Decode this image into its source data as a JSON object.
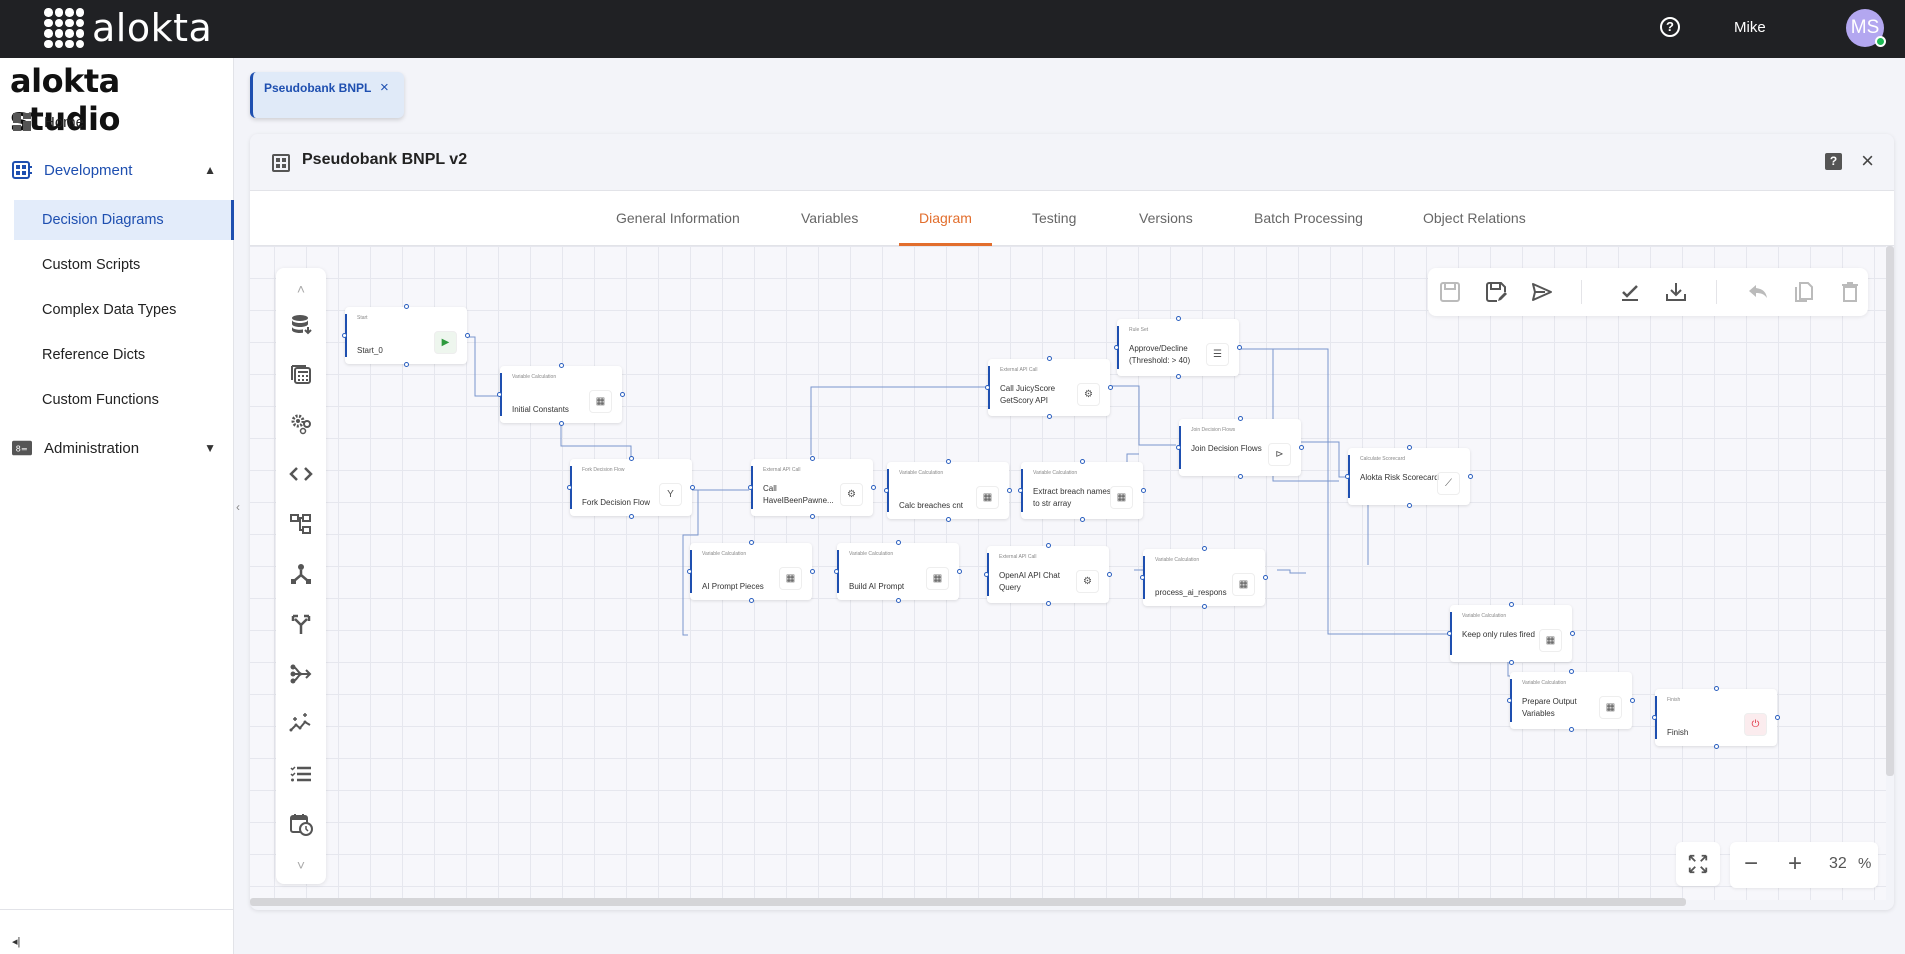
{
  "topbar": {
    "brand": "alokta",
    "help_icon": "help-circle-icon",
    "user_name": "Mike",
    "avatar_initials": "MS",
    "status_color": "#1db954"
  },
  "sidebar": {
    "title": "alokta studio",
    "items": [
      {
        "label": "Home",
        "icon": "dashboard-icon"
      },
      {
        "label": "Development",
        "icon": "development-icon",
        "expanded": true
      },
      {
        "label": "Administration",
        "icon": "admin-card-icon",
        "expanded": false
      }
    ],
    "sub_items": [
      {
        "label": "Decision Diagrams",
        "active": true
      },
      {
        "label": "Custom Scripts"
      },
      {
        "label": "Complex Data Types"
      },
      {
        "label": "Reference Dicts"
      },
      {
        "label": "Custom Functions"
      }
    ],
    "collapse_icon": "◂|",
    "toggle_icon": "‹"
  },
  "doc_tab": {
    "label": "Pseudobank BNPL",
    "close": "×"
  },
  "card": {
    "title": "Pseudobank BNPL v2",
    "help": "?",
    "close": "×"
  },
  "tabs": [
    {
      "label": "General Information"
    },
    {
      "label": "Variables"
    },
    {
      "label": "Diagram",
      "active": true
    },
    {
      "label": "Testing"
    },
    {
      "label": "Versions"
    },
    {
      "label": "Batch Processing"
    },
    {
      "label": "Object Relations"
    }
  ],
  "accent": "#e26e2d",
  "primary": "#1e4fb0",
  "palette": {
    "scroll_up": "˄",
    "scroll_down": "˅",
    "items": [
      "data-source-icon",
      "variable-calculation-icon",
      "external-api-icon",
      "custom-script-icon",
      "decision-tree-icon",
      "join-icon",
      "fork-icon",
      "merge-icon",
      "scorecard-icon",
      "rule-set-icon",
      "schedule-icon"
    ]
  },
  "toolbar": {
    "items": [
      "save-icon",
      "save-as-icon",
      "publish-icon",
      "validate-icon",
      "download-icon",
      "undo-icon",
      "copy-icon",
      "delete-icon"
    ]
  },
  "zoom": {
    "minus": "−",
    "plus": "+",
    "value": "32",
    "unit": "%"
  },
  "nodes": [
    {
      "id": "start",
      "type": "Start",
      "label": "Start_0",
      "icon": "play"
    },
    {
      "id": "initconst",
      "type": "Variable Calculation",
      "label": "Initial Constants",
      "icon": "calc"
    },
    {
      "id": "fork",
      "type": "Fork Decision Flow",
      "label": "Fork Decision Flow",
      "icon": "fork"
    },
    {
      "id": "hibp",
      "type": "External API Call",
      "label": "Call HaveIBeenPawne...",
      "icon": "api"
    },
    {
      "id": "calcbreach",
      "type": "Variable Calculation",
      "label": "Calc breaches cnt",
      "icon": "calc"
    },
    {
      "id": "extract",
      "type": "Variable Calculation",
      "label": "Extract breach names to str array",
      "icon": "calc"
    },
    {
      "id": "juicy",
      "type": "External API Call",
      "label": "Call JuicyScore GetScory API",
      "icon": "api"
    },
    {
      "id": "ruleset",
      "type": "Rule Set",
      "label": "Approve/Decline (Threshold: > 40)",
      "icon": "list"
    },
    {
      "id": "join",
      "type": "Join Decision Flows",
      "label": "Join Decision Flows",
      "icon": "join"
    },
    {
      "id": "scorecard",
      "type": "Calculate Scorecard",
      "label": "Alokta Risk Scorecard",
      "icon": "score"
    },
    {
      "id": "aipieces",
      "type": "Variable Calculation",
      "label": "AI Prompt Pieces",
      "icon": "calc"
    },
    {
      "id": "buildai",
      "type": "Variable Calculation",
      "label": "Build AI Prompt",
      "icon": "calc"
    },
    {
      "id": "openai",
      "type": "External API Call",
      "label": "OpenAI API Chat Query",
      "icon": "api"
    },
    {
      "id": "procai",
      "type": "Variable Calculation",
      "label": "process_ai_respons",
      "icon": "calc"
    },
    {
      "id": "keeprules",
      "type": "Variable Calculation",
      "label": "Keep only rules fired",
      "icon": "calc"
    },
    {
      "id": "prepout",
      "type": "Variable Calculation",
      "label": "Prepare Output Variables",
      "icon": "calc"
    },
    {
      "id": "finish",
      "type": "Finish",
      "label": "Finish",
      "icon": "power"
    }
  ]
}
